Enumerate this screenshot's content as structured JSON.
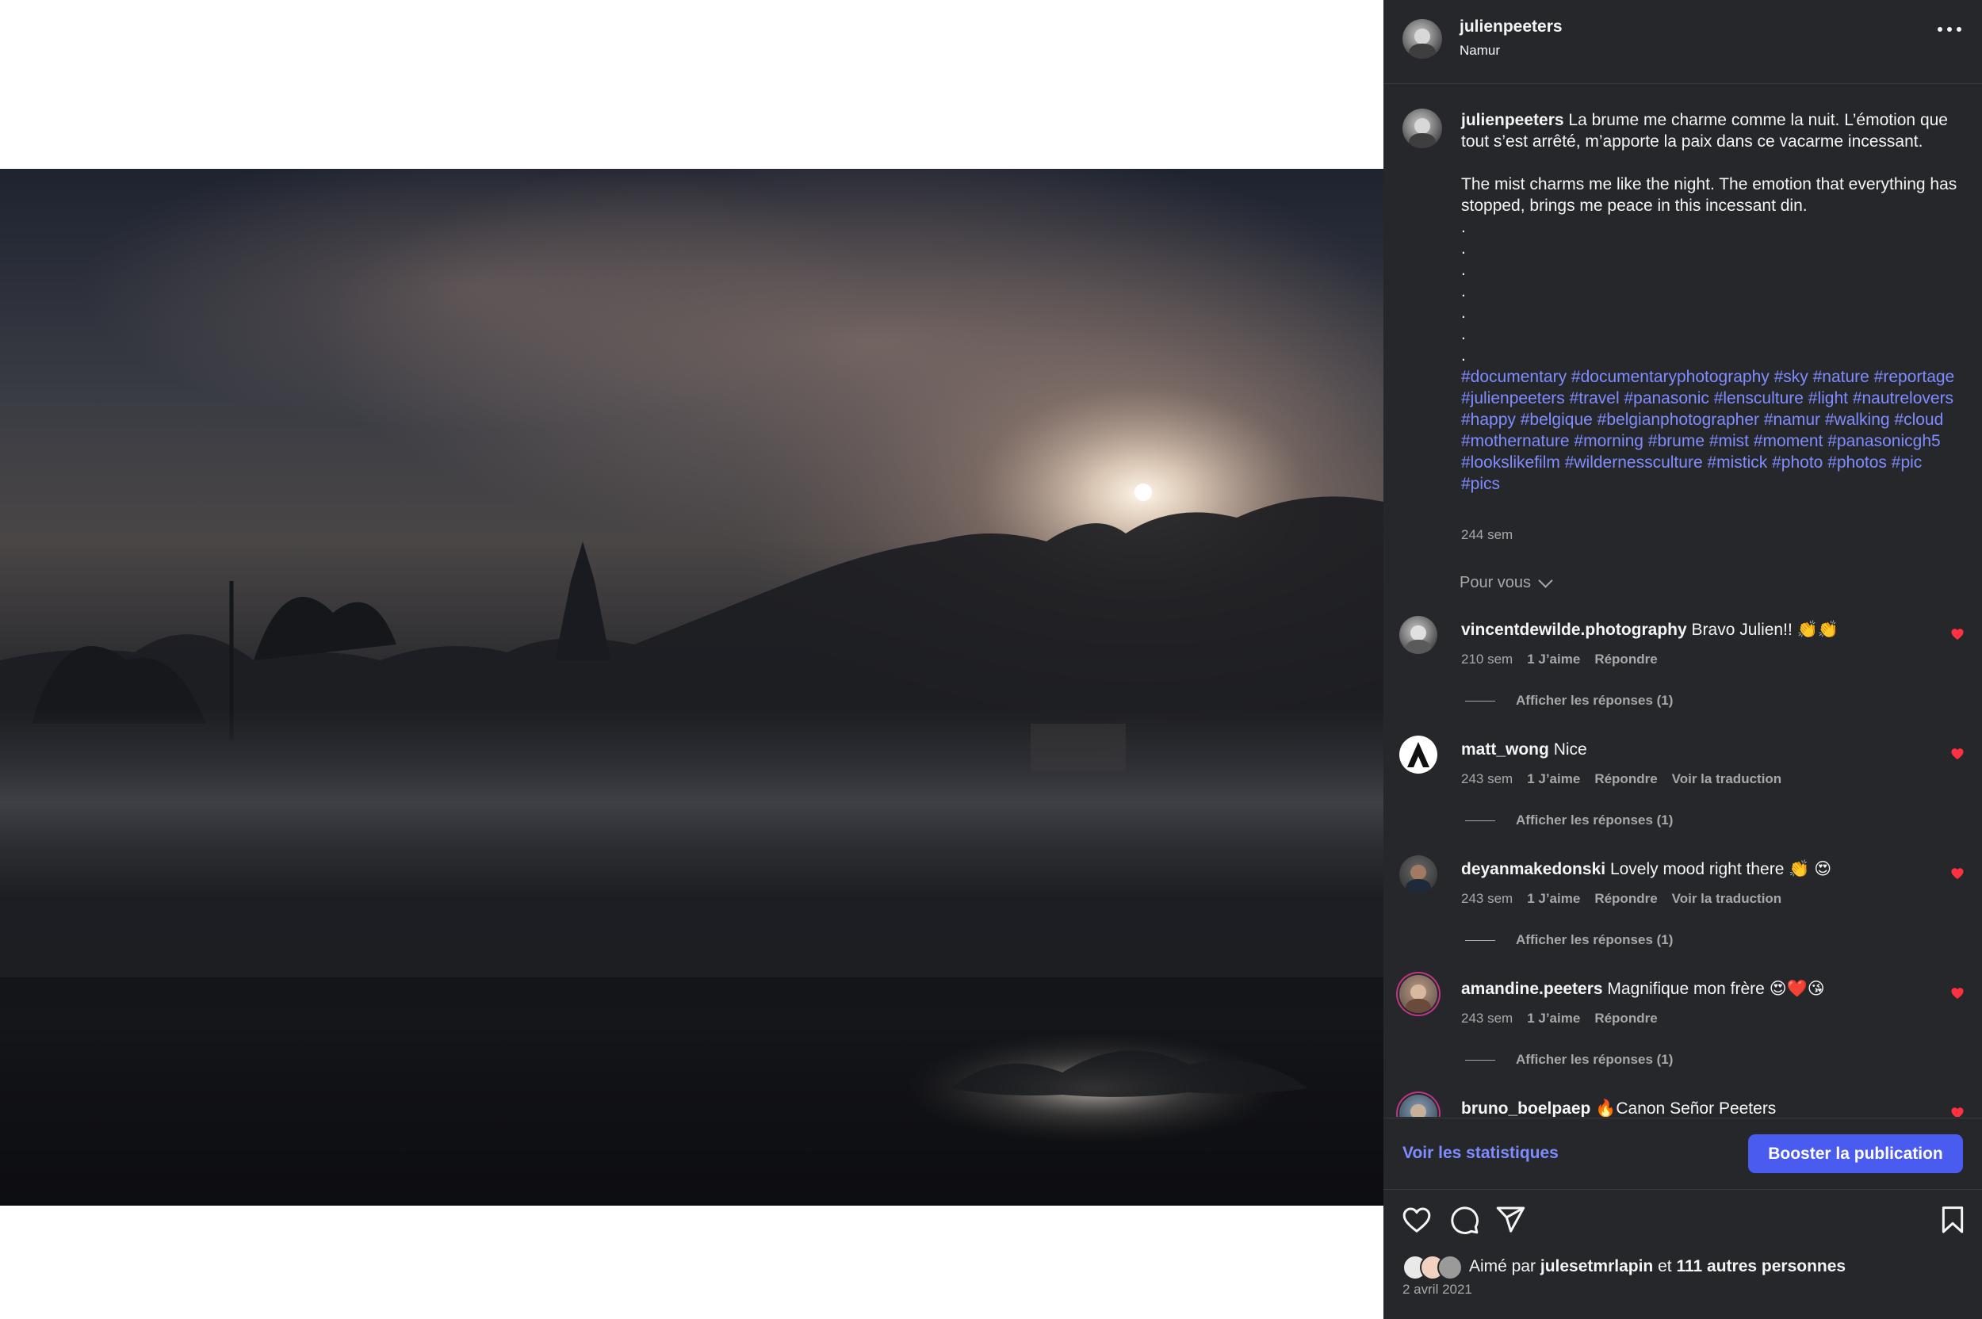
{
  "post": {
    "username": "julienpeeters",
    "location": "Namur"
  },
  "caption": {
    "username": "julienpeeters",
    "text_fr": "La brume me charme comme la nuit. L’émotion que tout s’est arrêté, m’apporte la paix dans ce vacarme incessant.",
    "text_en": "The mist charms me like the night. The emotion that everything has stopped, brings me peace in this incessant din.",
    "dots": [
      ".",
      ".",
      ".",
      ".",
      ".",
      ".",
      "."
    ],
    "hashtags": "#documentary #documentaryphotography #sky #nature #reportage #julienpeeters #travel #panasonic #lensculture #light #nautrelovers #happy #belgique #belgianphotographer #namur #walking #cloud #mothernature #morning #brume #mist #moment #panasonicgh5 #lookslikefilm #wildernessculture #mistick #photo #photos #pic #pics",
    "time": "244 sem"
  },
  "sort": {
    "label": "Pour vous"
  },
  "comments": [
    {
      "username": "vincentdewilde.photography",
      "text": "Bravo Julien!! 👏👏",
      "time": "210 sem",
      "likes": "1 J’aime",
      "reply": "Répondre",
      "translate": "",
      "replies": "Afficher les réponses (1)"
    },
    {
      "username": "matt_wong",
      "text": "Nice",
      "time": "243 sem",
      "likes": "1 J’aime",
      "reply": "Répondre",
      "translate": "Voir la traduction",
      "replies": "Afficher les réponses (1)"
    },
    {
      "username": "deyanmakedonski",
      "text": "Lovely mood right there 👏 😍",
      "time": "243 sem",
      "likes": "1 J’aime",
      "reply": "Répondre",
      "translate": "Voir la traduction",
      "replies": "Afficher les réponses (1)"
    },
    {
      "username": "amandine.peeters",
      "text": "Magnifique mon frère 😍❤️😘",
      "time": "243 sem",
      "likes": "1 J’aime",
      "reply": "Répondre",
      "translate": "",
      "replies": "Afficher les réponses (1)"
    },
    {
      "username": "bruno_boelpaep",
      "text": "🔥Canon Señor Peeters",
      "time": "",
      "likes": "",
      "reply": "",
      "translate": "",
      "replies": ""
    }
  ],
  "footer": {
    "stats_link": "Voir les statistiques",
    "boost_button": "Booster la publication",
    "liked_prefix": "Aimé par",
    "liked_user": "julesetmrlapin",
    "liked_middle": "et",
    "liked_others": "111 autres personnes",
    "date": "2 avril 2021"
  },
  "icons": {
    "more": "more-options-icon",
    "like": "heart-icon",
    "comment": "comment-icon",
    "share": "share-icon",
    "save": "bookmark-icon",
    "comment_like": "heart-filled-icon"
  },
  "colors": {
    "panel_bg": "#26272b",
    "hashtag": "#7f8cff",
    "boost": "#4a5cf0",
    "heart": "#ff3040"
  }
}
